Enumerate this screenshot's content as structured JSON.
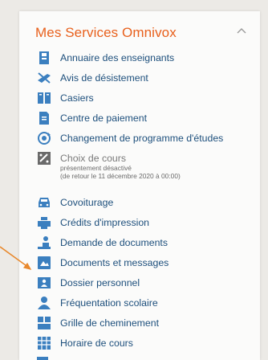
{
  "panel": {
    "title": "Mes Services Omnivox"
  },
  "items": [
    {
      "label": "Annuaire des enseignants",
      "icon": "directory-icon"
    },
    {
      "label": "Avis de désistement",
      "icon": "withdrawal-icon"
    },
    {
      "label": "Casiers",
      "icon": "lockers-icon"
    },
    {
      "label": "Centre de paiement",
      "icon": "payment-icon"
    },
    {
      "label": "Changement de programme d'études",
      "icon": "program-change-icon"
    },
    {
      "label": "Choix de cours",
      "icon": "course-choice-icon",
      "note1": "présentement désactivé",
      "note2": "(de retour le 11 décembre 2020 à 00:00)"
    },
    {
      "label": "Covoiturage",
      "icon": "car-icon"
    },
    {
      "label": "Crédits d'impression",
      "icon": "printer-icon"
    },
    {
      "label": "Demande de documents",
      "icon": "document-request-icon"
    },
    {
      "label": "Documents et messages",
      "icon": "documents-messages-icon"
    },
    {
      "label": "Dossier personnel",
      "icon": "personal-file-icon"
    },
    {
      "label": "Fréquentation scolaire",
      "icon": "attendance-icon"
    },
    {
      "label": "Grille de cheminement",
      "icon": "progress-grid-icon"
    },
    {
      "label": "Horaire de cours",
      "icon": "schedule-icon"
    }
  ],
  "colors": {
    "title": "#e8601c",
    "link": "#1d4f7c",
    "icon": "#3b7fbf",
    "arrow": "#e8892e"
  }
}
